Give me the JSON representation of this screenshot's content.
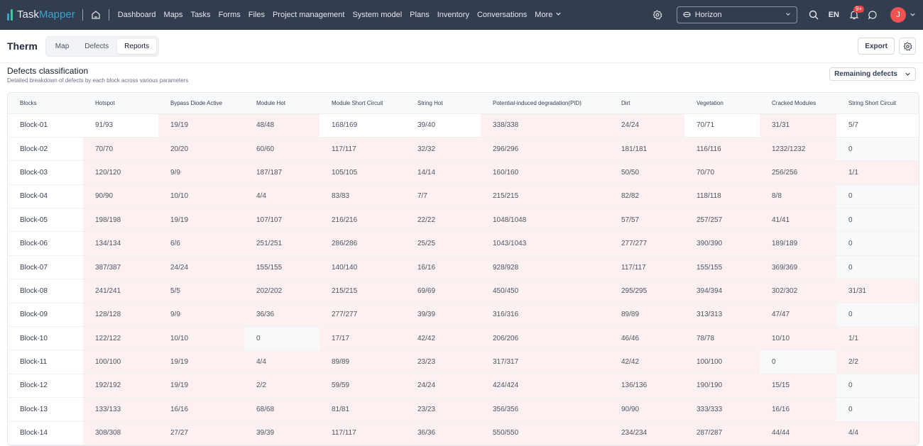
{
  "app": {
    "brand_part1": "Task",
    "brand_part2": "Mapper",
    "nav": [
      "Dashboard",
      "Maps",
      "Tasks",
      "Forms",
      "Files",
      "Project management",
      "System model",
      "Plans",
      "Inventory",
      "Conversations",
      "More"
    ],
    "project": "Horizon",
    "language": "EN",
    "notification_badge": "9+",
    "avatar_initial": "J",
    "colors": {
      "topbar": "#323d4f",
      "avatar": "#f05252",
      "badge": "#ef4444",
      "full_cell": "#fdf0f0",
      "zero_cell": "#f8f9fb"
    }
  },
  "page": {
    "title": "Therm",
    "tabs": [
      {
        "label": "Map",
        "active": false
      },
      {
        "label": "Defects",
        "active": false
      },
      {
        "label": "Reports",
        "active": true
      }
    ],
    "export_label": "Export"
  },
  "section": {
    "title": "Defects classification",
    "subtitle": "Detailed breakdown of defects by each block across various parameters",
    "filter": "Remaining defects"
  },
  "table": {
    "columns": [
      "Blocks",
      "Hotspot",
      "Bypass Diode Active",
      "Module Hot",
      "Module Short Circuit",
      "String Hot",
      "Potential-induced degradation(PID)",
      "Dirt",
      "Vegetation",
      "Cracked Modules",
      "String Short Circuit"
    ],
    "rows": [
      [
        "Block-01",
        "91/93",
        "19/19",
        "48/48",
        "168/169",
        "39/40",
        "338/338",
        "24/24",
        "70/71",
        "31/31",
        "5/7"
      ],
      [
        "Block-02",
        "70/70",
        "20/20",
        "60/60",
        "117/117",
        "32/32",
        "296/296",
        "181/181",
        "116/116",
        "1232/1232",
        "0"
      ],
      [
        "Block-03",
        "120/120",
        "9/9",
        "187/187",
        "105/105",
        "14/14",
        "160/160",
        "50/50",
        "70/70",
        "256/256",
        "1/1"
      ],
      [
        "Block-04",
        "90/90",
        "10/10",
        "4/4",
        "83/83",
        "7/7",
        "215/215",
        "82/82",
        "118/118",
        "8/8",
        "0"
      ],
      [
        "Block-05",
        "198/198",
        "19/19",
        "107/107",
        "216/216",
        "22/22",
        "1048/1048",
        "57/57",
        "257/257",
        "41/41",
        "0"
      ],
      [
        "Block-06",
        "134/134",
        "6/6",
        "251/251",
        "286/286",
        "25/25",
        "1043/1043",
        "277/277",
        "390/390",
        "189/189",
        "0"
      ],
      [
        "Block-07",
        "387/387",
        "24/24",
        "155/155",
        "140/140",
        "16/16",
        "928/928",
        "117/117",
        "155/155",
        "369/369",
        "0"
      ],
      [
        "Block-08",
        "241/241",
        "5/5",
        "202/202",
        "215/215",
        "69/69",
        "450/450",
        "295/295",
        "394/394",
        "302/302",
        "31/31"
      ],
      [
        "Block-09",
        "128/128",
        "9/9",
        "36/36",
        "277/277",
        "39/39",
        "316/316",
        "89/89",
        "313/313",
        "47/47",
        "0"
      ],
      [
        "Block-10",
        "122/122",
        "10/10",
        "0",
        "17/17",
        "42/42",
        "206/206",
        "46/46",
        "78/78",
        "10/10",
        "1/1"
      ],
      [
        "Block-11",
        "100/100",
        "19/19",
        "4/4",
        "89/89",
        "23/23",
        "317/317",
        "42/42",
        "100/100",
        "0",
        "2/2"
      ],
      [
        "Block-12",
        "192/192",
        "19/19",
        "2/2",
        "59/59",
        "24/24",
        "424/424",
        "136/136",
        "190/190",
        "15/15",
        "0"
      ],
      [
        "Block-13",
        "133/133",
        "16/16",
        "68/68",
        "81/81",
        "23/23",
        "356/356",
        "90/90",
        "333/333",
        "16/16",
        "0"
      ],
      [
        "Block-14",
        "308/308",
        "27/27",
        "39/39",
        "117/117",
        "36/36",
        "550/550",
        "234/234",
        "287/287",
        "44/44",
        "4/4"
      ]
    ]
  }
}
